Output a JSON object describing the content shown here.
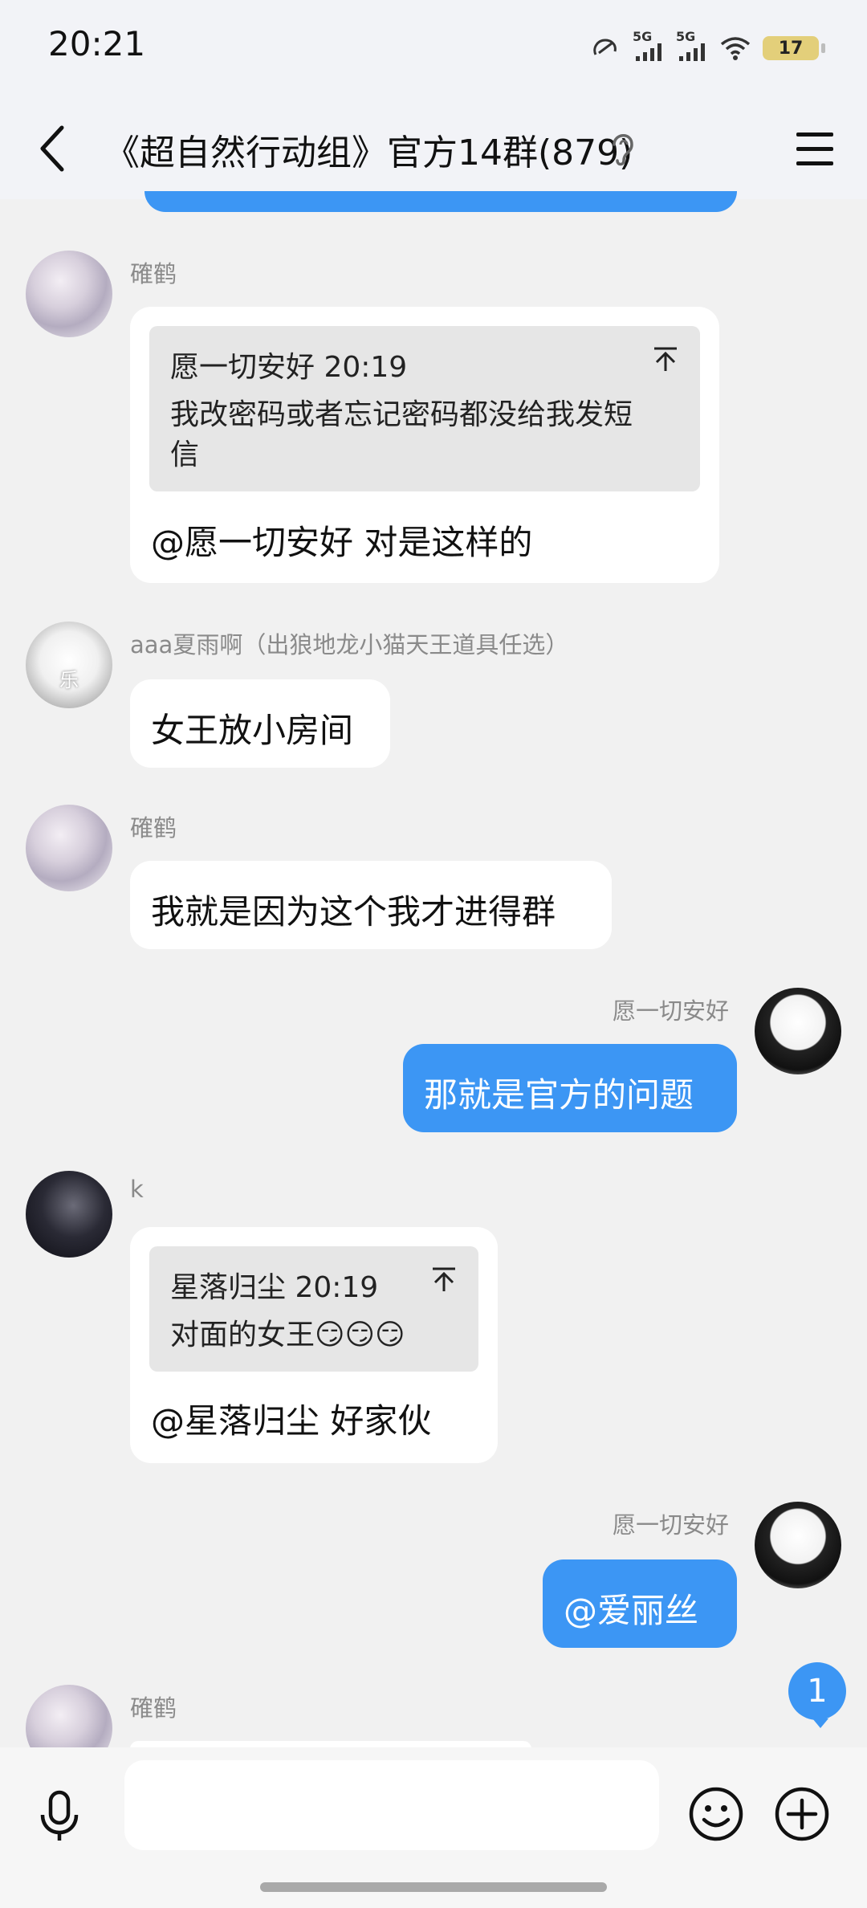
{
  "status_bar": {
    "time": "20:21",
    "battery": "17",
    "net1": "5G",
    "net2": "5G"
  },
  "header": {
    "title": "《超自然行动组》官方14群(879)"
  },
  "messages": [
    {
      "sender": "確鹤",
      "quote_header": "愿一切安好 20:19",
      "quote_line1": "我改密码或者忘记密码都没给我发短",
      "quote_line2": "信",
      "text": "@愿一切安好 对是这样的"
    },
    {
      "sender": "aaa夏雨啊（出狼地龙小猫天王道具任选）",
      "avatar_text": "乐",
      "text": "女王放小房间"
    },
    {
      "sender": "確鹤",
      "text": "我就是因为这个我才进得群"
    },
    {
      "sender": "愿一切安好",
      "text": "那就是官方的问题"
    },
    {
      "sender": "k",
      "quote_header": "星落归尘 20:19",
      "quote_body": "对面的女王😏😏😏",
      "text": "@星落归尘 好家伙"
    },
    {
      "sender": "愿一切安好",
      "text": "@爱丽丝"
    },
    {
      "sender": "確鹤"
    }
  ],
  "unread_count": "1",
  "input": {
    "placeholder": ""
  },
  "colors": {
    "accent": "#3c96f4",
    "background": "#f1f1f1",
    "header": "#f2f3f7"
  }
}
